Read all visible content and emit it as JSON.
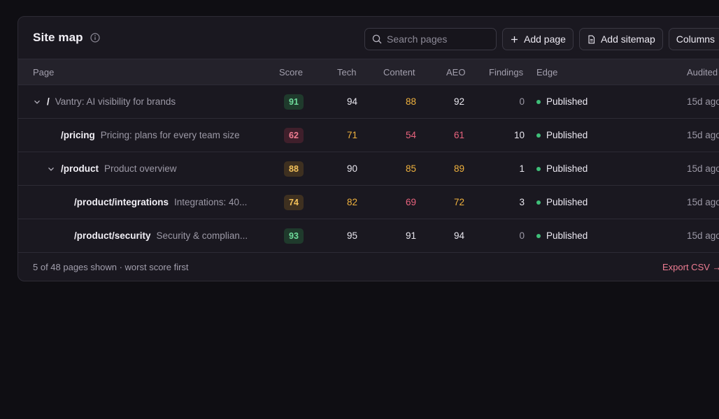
{
  "header": {
    "title": "Site map",
    "info_icon": "info-circle-icon"
  },
  "toolbar": {
    "search_placeholder": "Search pages",
    "search_value": "",
    "add_page_label": "Add page",
    "add_sitemap_label": "Add sitemap",
    "columns_label": "Columns"
  },
  "table": {
    "columns": {
      "page": "Page",
      "score": "Score",
      "tech": "Tech",
      "content": "Content",
      "aeo": "AEO",
      "findings": "Findings",
      "edge": "Edge",
      "audited": "Audited"
    },
    "rows": [
      {
        "path": "/",
        "desc": "Vantry: AI visibility for brands",
        "score": "91",
        "tech": "94",
        "content": "88",
        "aeo": "92",
        "findings": "0",
        "edge": "Published",
        "audited": "15d ago"
      },
      {
        "path": "/pricing",
        "desc": "Pricing: plans for every team size",
        "score": "62",
        "tech": "71",
        "content": "54",
        "aeo": "61",
        "findings": "10",
        "edge": "Published",
        "audited": "15d ago"
      },
      {
        "path": "/product",
        "desc": "Product overview",
        "score": "88",
        "tech": "90",
        "content": "85",
        "aeo": "89",
        "findings": "1",
        "edge": "Published",
        "audited": "15d ago"
      },
      {
        "path": "/product/integrations",
        "desc": "Integrations: 40...",
        "score": "74",
        "tech": "82",
        "content": "69",
        "aeo": "72",
        "findings": "3",
        "edge": "Published",
        "audited": "15d ago"
      },
      {
        "path": "/product/security",
        "desc": "Security & complian...",
        "score": "93",
        "tech": "95",
        "content": "91",
        "aeo": "94",
        "findings": "0",
        "edge": "Published",
        "audited": "15d ago"
      }
    ]
  },
  "footer": {
    "summary": "5 of 48 pages shown · worst score first",
    "export_label": "Export CSV →"
  },
  "colors": {
    "good": "#e8e6ee",
    "warn": "#f0b23e",
    "bad": "#e8637d",
    "badge_good_bg": "#1f3a2c",
    "badge_good_fg": "#6fdc9c",
    "badge_warn_bg": "#3e3020",
    "badge_warn_fg": "#f3c15a",
    "badge_bad_bg": "#3f1f2b",
    "badge_bad_fg": "#f07d92",
    "published_dot": "#3fbf78",
    "accent": "#ef7d93"
  }
}
